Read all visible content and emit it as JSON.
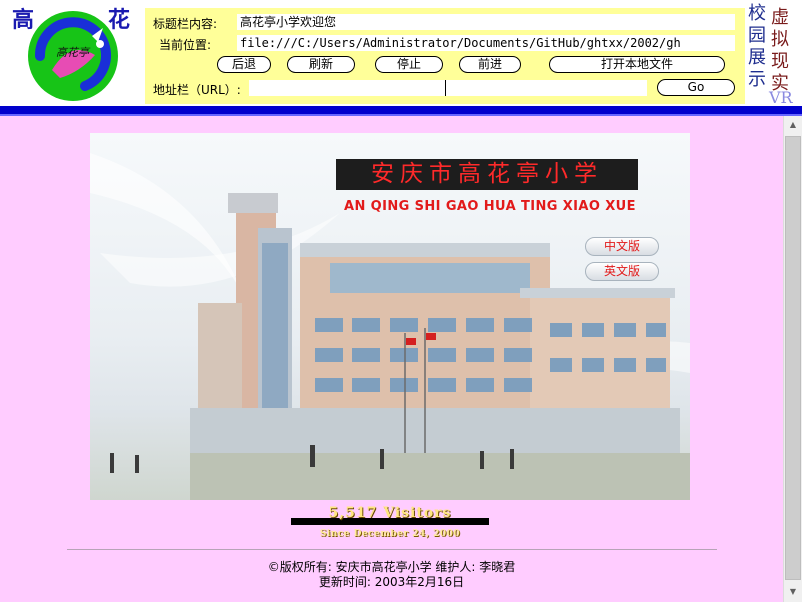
{
  "toolbar": {
    "logo_chars": [
      "高",
      "花"
    ],
    "logo_badge_text": "高花亭",
    "title_label": "标题栏内容:",
    "title_value": "高花亭小学欢迎您",
    "location_label": "当前位置:",
    "location_value": "file:///C:/Users/Administrator/Documents/GitHub/ghtxx/2002/gh",
    "buttons": {
      "back": "后退",
      "refresh": "刷新",
      "stop": "停止",
      "forward": "前进",
      "open_local": "打开本地文件"
    },
    "url_label": "地址栏（URL）:",
    "url_value": "",
    "go": "Go",
    "vr_chars": {
      "col1": [
        "校",
        "园",
        "展",
        "示"
      ],
      "col2": [
        "虚",
        "拟",
        "现",
        "实"
      ],
      "vr": "VR"
    },
    "colors": {
      "panel": "#ffff99",
      "bar": "#0000cc"
    }
  },
  "content": {
    "hero": {
      "title": "安庆市高花亭小学",
      "pinyin": "AN QING SHI GAO HUA TING XIAO XUE",
      "sign_text": "高花亭小学",
      "lang_cn": "中文版",
      "lang_en": "英文版"
    },
    "counter": "5,517 Visitors",
    "since": "Since December 24, 2000",
    "copyright": "©版权所有: 安庆市高花亭小学  维护人: 李晓君",
    "updated": "更新时间: 2003年2月16日",
    "colors": {
      "background": "#ffccff"
    }
  }
}
